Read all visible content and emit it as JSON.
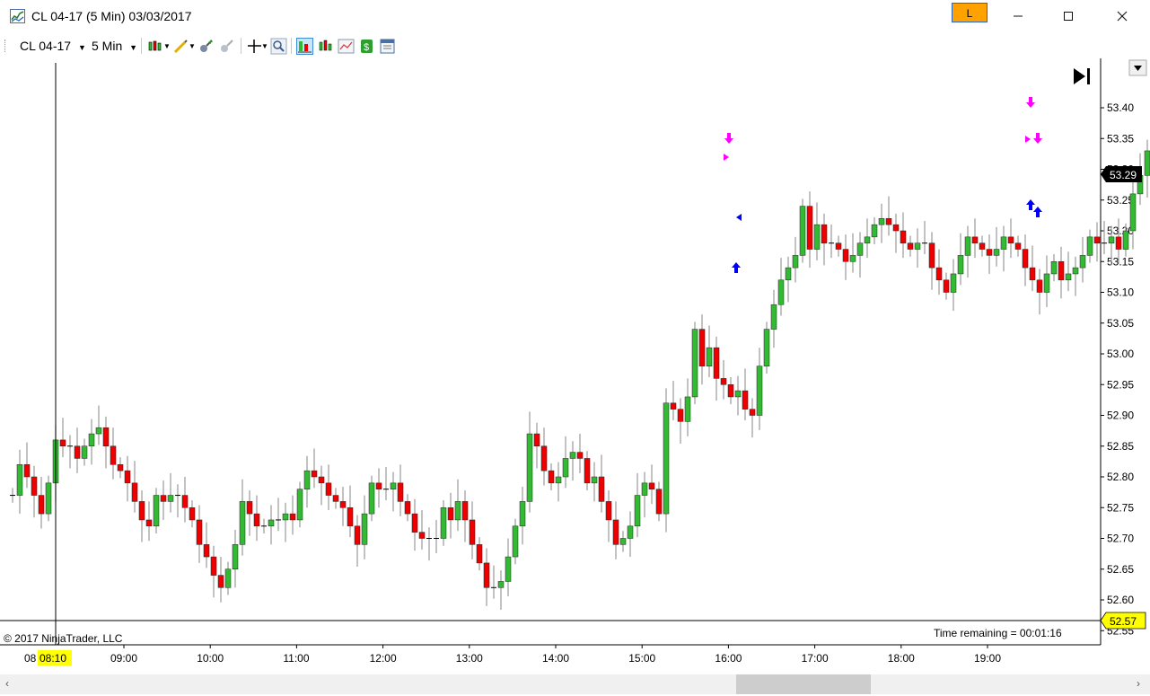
{
  "window": {
    "title": "CL 04-17 (5 Min)  03/03/2017",
    "link_label": "L"
  },
  "toolbar": {
    "instrument": "CL 04-17",
    "interval": "5 Min"
  },
  "chart": {
    "copyright": "© 2017 NinjaTrader, LLC",
    "time_remaining": "Time remaining = 00:01:16",
    "current_price_label": "53.29",
    "crosshair_price_label": "52.57",
    "crosshair_time_prefix": "08",
    "crosshair_time_label": "08:10",
    "colors": {
      "up": "#33b933",
      "down": "#ee0000",
      "wick": "#999999",
      "buy_arrow": "#0000ff",
      "sell_arrow": "#ff00ff",
      "time_highlight": "#ffff00"
    }
  },
  "chart_data": {
    "type": "candlestick",
    "instrument": "CL 04-17",
    "interval": "5 Min",
    "date": "03/03/2017",
    "y_ticks": [
      "53.40",
      "53.35",
      "53.30",
      "53.25",
      "53.20",
      "53.15",
      "53.10",
      "53.05",
      "53.00",
      "52.95",
      "52.90",
      "52.85",
      "52.80",
      "52.75",
      "52.70",
      "52.65",
      "52.60",
      "52.55"
    ],
    "x_ticks": [
      "09:00",
      "10:00",
      "11:00",
      "12:00",
      "13:00",
      "14:00",
      "15:00",
      "16:00",
      "17:00",
      "18:00",
      "19:00"
    ],
    "ylim": [
      52.53,
      53.45
    ],
    "candles_close": [
      52.77,
      52.82,
      52.8,
      52.77,
      52.74,
      52.79,
      52.86,
      52.85,
      52.85,
      52.83,
      52.85,
      52.87,
      52.88,
      52.85,
      52.82,
      52.81,
      52.79,
      52.76,
      52.73,
      52.72,
      52.77,
      52.76,
      52.77,
      52.77,
      52.75,
      52.73,
      52.69,
      52.67,
      52.64,
      52.62,
      52.65,
      52.69,
      52.76,
      52.74,
      52.72,
      52.72,
      52.73,
      52.73,
      52.74,
      52.73,
      52.78,
      52.81,
      52.8,
      52.79,
      52.77,
      52.76,
      52.75,
      52.72,
      52.69,
      52.74,
      52.79,
      52.78,
      52.78,
      52.79,
      52.76,
      52.74,
      52.71,
      52.7,
      52.7,
      52.7,
      52.75,
      52.73,
      52.76,
      52.73,
      52.69,
      52.66,
      52.62,
      52.62,
      52.63,
      52.67,
      52.72,
      52.76,
      52.87,
      52.85,
      52.81,
      52.79,
      52.8,
      52.83,
      52.84,
      52.83,
      52.79,
      52.8,
      52.76,
      52.73,
      52.69,
      52.7,
      52.72,
      52.77,
      52.79,
      52.78,
      52.74,
      52.92,
      52.91,
      52.89,
      52.93,
      53.04,
      52.98,
      53.01,
      52.96,
      52.95,
      52.93,
      52.94,
      52.91,
      52.9,
      52.98,
      53.04,
      53.08,
      53.12,
      53.14,
      53.16,
      53.24,
      53.17,
      53.21,
      53.18,
      53.18,
      53.17,
      53.15,
      53.16,
      53.18,
      53.19,
      53.21,
      53.22,
      53.21,
      53.2,
      53.18,
      53.17,
      53.18,
      53.18,
      53.14,
      53.12,
      53.1,
      53.13,
      53.16,
      53.19,
      53.18,
      53.17,
      53.16,
      53.17,
      53.19,
      53.18,
      53.17,
      53.14,
      53.12,
      53.1,
      53.13,
      53.15,
      53.12,
      53.13,
      53.14,
      53.16,
      53.19,
      53.18,
      53.18,
      53.19,
      53.17,
      53.2,
      53.26,
      53.29,
      53.33,
      53.26,
      53.27,
      53.28,
      53.29
    ]
  }
}
